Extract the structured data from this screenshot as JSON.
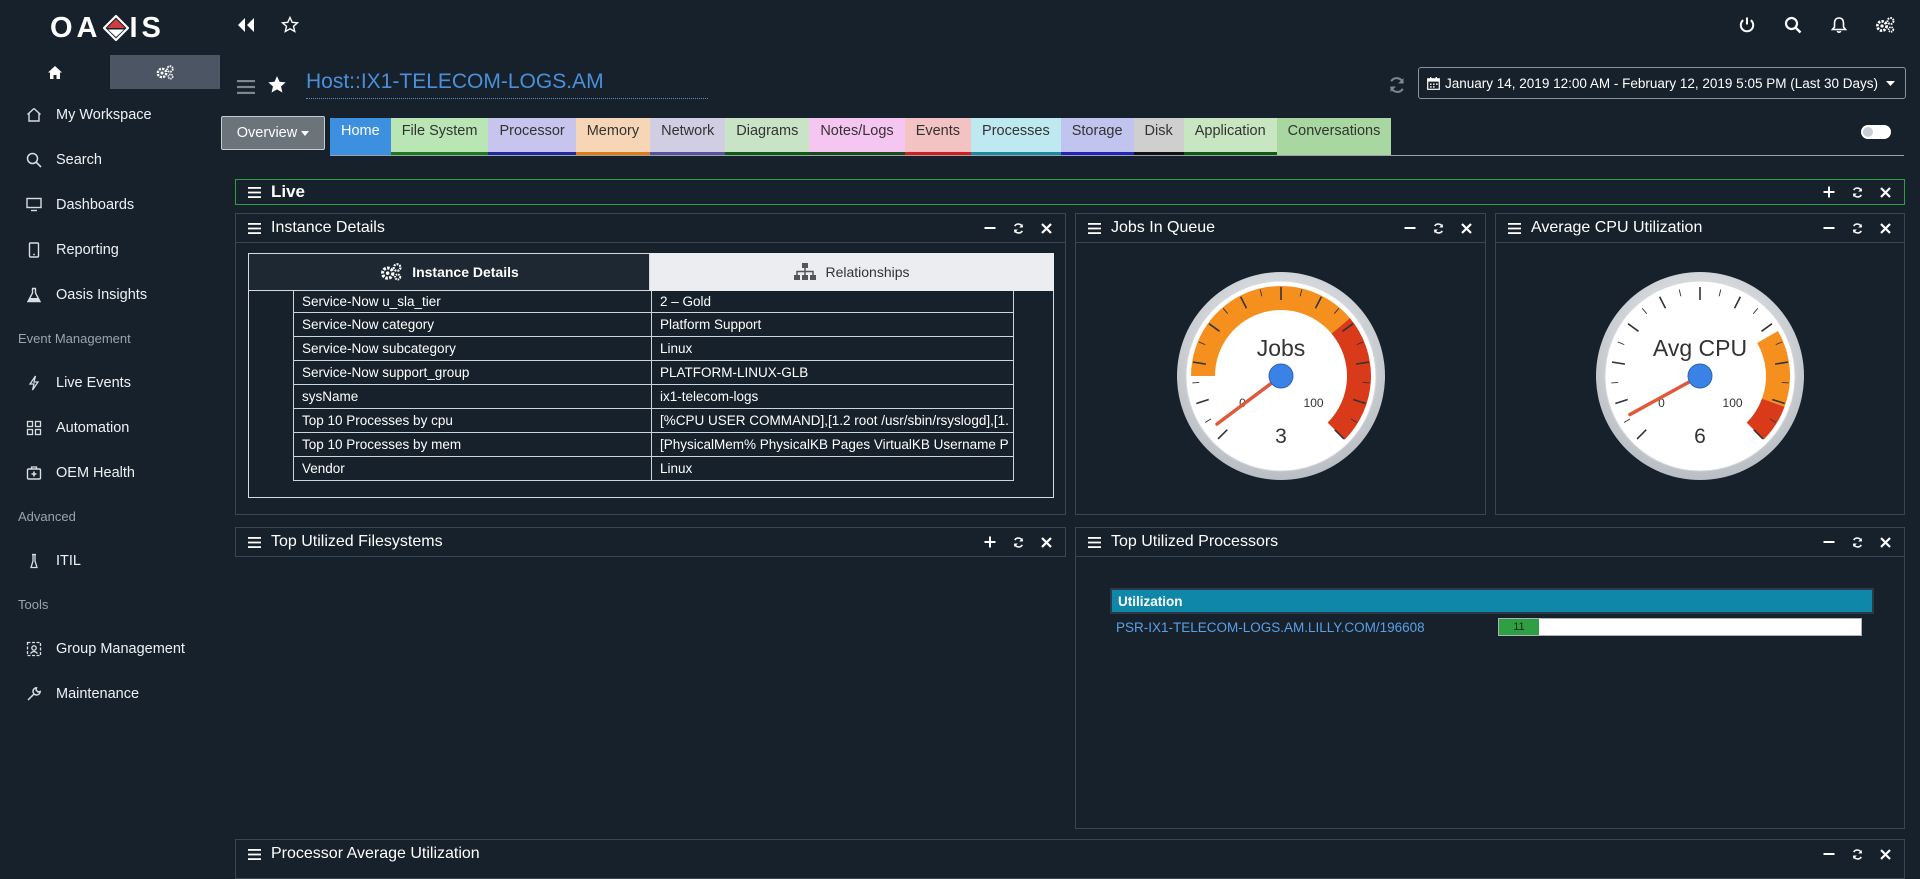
{
  "app": {
    "logo_text_left": "OA",
    "logo_text_right": "IS"
  },
  "sidebar": {
    "items": [
      {
        "label": "My Workspace",
        "icon": "home-icon"
      },
      {
        "label": "Search",
        "icon": "search-icon"
      },
      {
        "label": "Dashboards",
        "icon": "monitor-icon"
      },
      {
        "label": "Reporting",
        "icon": "tablet-icon"
      },
      {
        "label": "Oasis Insights",
        "icon": "flask-icon"
      }
    ],
    "section_event": "Event Management",
    "event_items": [
      {
        "label": "Live Events",
        "icon": "bolt-icon"
      },
      {
        "label": "Automation",
        "icon": "grid-icon"
      },
      {
        "label": "OEM Health",
        "icon": "medkit-icon"
      }
    ],
    "section_advanced": "Advanced",
    "advanced_items": [
      {
        "label": "ITIL",
        "icon": "beaker-icon"
      }
    ],
    "section_tools": "Tools",
    "tools_items": [
      {
        "label": "Group Management",
        "icon": "group-icon"
      },
      {
        "label": "Maintenance",
        "icon": "wrench-icon"
      }
    ]
  },
  "header": {
    "title": "Host::IX1-TELECOM-LOGS.AM",
    "date_range": "January 14, 2019 12:00 AM - February 12, 2019 5:05 PM (Last 30 Days)",
    "overview_label": "Overview"
  },
  "tabs": [
    {
      "label": "Home",
      "bg": "#3d8fe0",
      "border": "#3d8fe0",
      "fg": "#ffffff"
    },
    {
      "label": "File System",
      "bg": "#b9e6b4",
      "border": "#1e7a1e",
      "fg": "#333333"
    },
    {
      "label": "Processor",
      "bg": "#c7c4ee",
      "border": "#1f2a9e",
      "fg": "#333333"
    },
    {
      "label": "Memory",
      "bg": "#f7d6b8",
      "border": "#e07b1a",
      "fg": "#333333"
    },
    {
      "label": "Network",
      "bg": "#d1cde3",
      "border": "#5a50a0",
      "fg": "#333333"
    },
    {
      "label": "Diagrams",
      "bg": "#c9e3c6",
      "border": "#0e5a10",
      "fg": "#333333"
    },
    {
      "label": "Notes/Logs",
      "bg": "#f6c6f3",
      "border": "#1a4a1a",
      "fg": "#333333"
    },
    {
      "label": "Events",
      "bg": "#f3c2c2",
      "border": "#d21f1f",
      "fg": "#333333"
    },
    {
      "label": "Processes",
      "bg": "#bfe9f1",
      "border": "#1a8aa0",
      "fg": "#333333"
    },
    {
      "label": "Storage",
      "bg": "#c0c4ef",
      "border": "#2624b8",
      "fg": "#333333"
    },
    {
      "label": "Disk",
      "bg": "#cfcfcf",
      "border": "#111111",
      "fg": "#333333"
    },
    {
      "label": "Application",
      "bg": "#c9e6c2",
      "border": "#0e5a10",
      "fg": "#333333"
    },
    {
      "label": "Conversations",
      "bg": "#a9d7a1",
      "border": "#a9d7a1",
      "fg": "#333333"
    }
  ],
  "live": {
    "title": "Live"
  },
  "instance": {
    "title": "Instance Details",
    "tab_details": "Instance Details",
    "tab_relationships": "Relationships",
    "rows": [
      {
        "key": "Service-Now u_sla_tier",
        "value": "2 – Gold"
      },
      {
        "key": "Service-Now category",
        "value": "Platform Support"
      },
      {
        "key": "Service-Now subcategory",
        "value": "Linux"
      },
      {
        "key": "Service-Now support_group",
        "value": "PLATFORM-LINUX-GLB"
      },
      {
        "key": "sysName",
        "value": "ix1-telecom-logs"
      },
      {
        "key": "Top 10 Processes by cpu",
        "value": "[%CPU USER COMMAND],[1.2 root /usr/sbin/rsyslogd],[1."
      },
      {
        "key": "Top 10 Processes by mem",
        "value": "[PhysicalMem% PhysicalKB Pages VirtualKB Username P"
      },
      {
        "key": "Vendor",
        "value": "Linux"
      }
    ]
  },
  "jobs": {
    "title": "Jobs In Queue",
    "label": "Jobs",
    "value": 3,
    "min": 0,
    "max": 100,
    "min_label": "0",
    "max_label": "100",
    "value_label": "3"
  },
  "cpu": {
    "title": "Average CPU Utilization",
    "label": "Avg CPU",
    "value": 6,
    "min": 0,
    "max": 100,
    "min_label": "0",
    "max_label": "100",
    "value_label": "6"
  },
  "filesystems": {
    "title": "Top Utilized Filesystems"
  },
  "processors": {
    "title": "Top Utilized Processors",
    "header": "Utilization",
    "rows": [
      {
        "name": "PSR-IX1-TELECOM-LOGS.AM.LILLY.COM/196608",
        "value": 11,
        "value_label": "11"
      }
    ]
  },
  "proc_avg": {
    "title": "Processor Average Utilization"
  },
  "colors": {
    "accent": "#4a90d9",
    "bg": "#17212b",
    "live_border": "#2ea043"
  }
}
